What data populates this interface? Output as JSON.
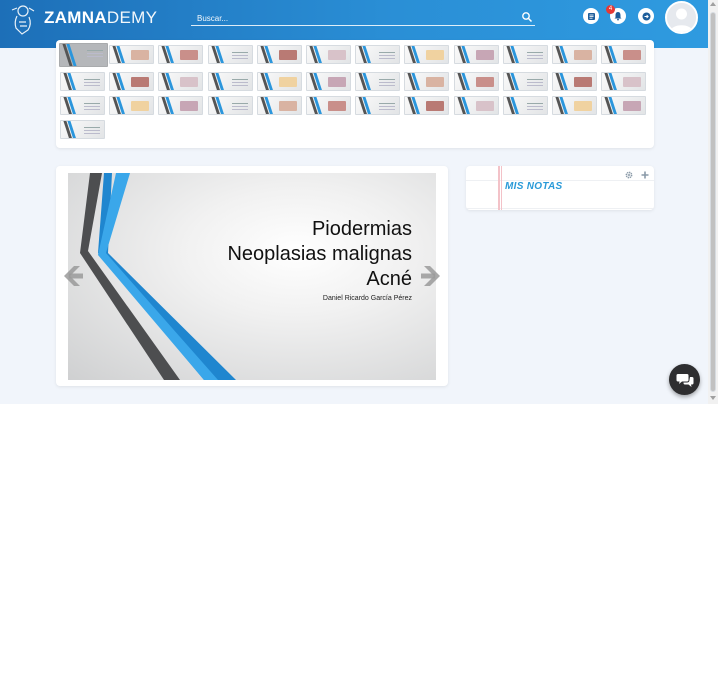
{
  "header": {
    "brand_bold": "ZAMNA",
    "brand_light": "DEMY",
    "search_placeholder": "Buscar...",
    "notifications_count": "4"
  },
  "icons": {
    "logo": "mayan-logo-icon",
    "search": "search-icon",
    "courses": "book-icon",
    "notifications": "bell-icon",
    "logout": "logout-icon",
    "avatar": "user-avatar-icon",
    "prev": "chevron-left-icon",
    "next": "chevron-right-icon",
    "settings": "gear-icon",
    "add": "plus-icon",
    "chat": "chat-icon"
  },
  "colors": {
    "header_start": "#1d6fb8",
    "header_end": "#2f9be0",
    "accent": "#2a9ad8",
    "badge": "#e53935",
    "page_bg": "#f1f5fb"
  },
  "slide": {
    "title_lines": [
      "Piodermias",
      "Neoplasias malignas",
      "Acné"
    ],
    "author": "Daniel Ricardo García Pérez"
  },
  "notes": {
    "title": "MIS NOTAS"
  },
  "thumbnails": {
    "count": 37,
    "active_index": 0
  }
}
